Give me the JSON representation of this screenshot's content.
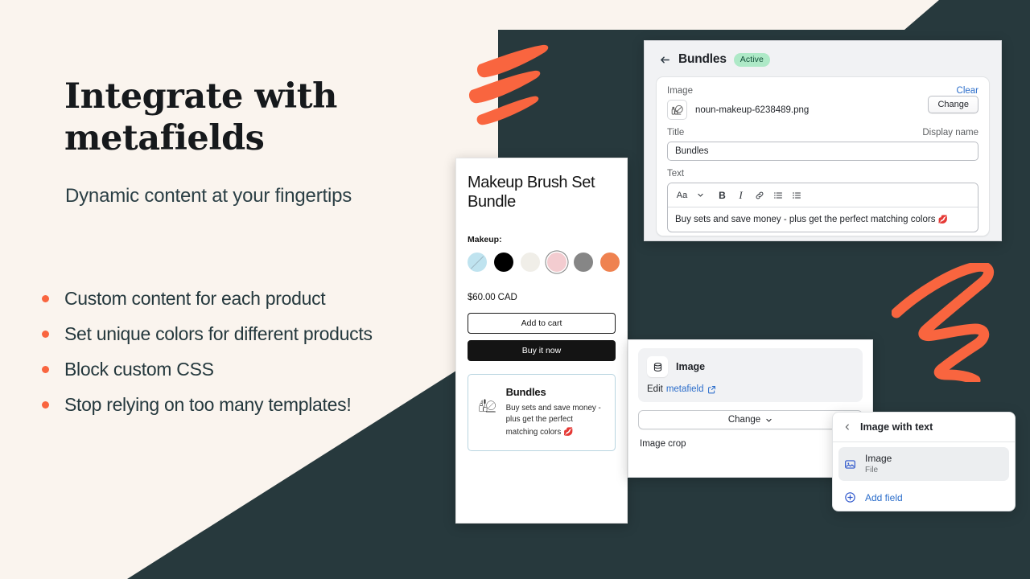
{
  "theme": {
    "cream": "#faf4ee",
    "dark": "#27393d",
    "accent": "#f9653f",
    "link_blue": "#2c6ecb",
    "badge_green": "#aee9c7"
  },
  "hero": {
    "headline_line1": "Integrate with",
    "headline_line2": "metafields",
    "subhead": "Dynamic content at your fingertips",
    "bullets": [
      "Custom content for each product",
      "Set unique colors for different products",
      "Block custom CSS",
      "Stop relying on too many templates!"
    ]
  },
  "admin_panel": {
    "back_icon": "arrow-left-icon",
    "title": "Bundles",
    "status_badge": "Active",
    "image_field": {
      "label": "Image",
      "clear_label": "Clear",
      "change_label": "Change",
      "filename": "noun-makeup-6238489.png",
      "thumb_icon": "makeup-thumbnail-icon"
    },
    "title_field": {
      "label": "Title",
      "helper": "Display name",
      "value": "Bundles"
    },
    "text_field": {
      "label": "Text",
      "toolbar": [
        {
          "name": "text-style-button",
          "glyph": "Aa"
        },
        {
          "name": "chevron-down-icon",
          "glyph": "⌄"
        },
        {
          "name": "bold-button",
          "glyph": "B"
        },
        {
          "name": "italic-button",
          "glyph": "I"
        },
        {
          "name": "link-button",
          "glyph": "link-icon"
        },
        {
          "name": "bulleted-list-button",
          "glyph": "list-icon"
        },
        {
          "name": "numbered-list-button",
          "glyph": "ordered-list-icon"
        }
      ],
      "body": "Buy sets and save money - plus get the perfect matching colors",
      "body_emoji": "💋"
    }
  },
  "storefront": {
    "product_title": "Makeup Brush Set Bundle",
    "option_label": "Makeup:",
    "swatches": [
      {
        "name": "swatch-light-blue",
        "color": "#bfe3ef",
        "unavailable": true,
        "selected": false
      },
      {
        "name": "swatch-black",
        "color": "#000000",
        "unavailable": false,
        "selected": false
      },
      {
        "name": "swatch-cream",
        "color": "#f0eee8",
        "unavailable": false,
        "selected": false
      },
      {
        "name": "swatch-pink",
        "color": "#f3ccd0",
        "unavailable": false,
        "selected": true
      },
      {
        "name": "swatch-gray",
        "color": "#868686",
        "unavailable": false,
        "selected": false
      },
      {
        "name": "swatch-orange",
        "color": "#ef8250",
        "unavailable": false,
        "selected": false
      }
    ],
    "price": "$60.00 CAD",
    "add_to_cart_label": "Add to cart",
    "buy_now_label": "Buy it now",
    "bundle_block": {
      "icon": "makeup-illustration-icon",
      "title": "Bundles",
      "description": "Buy sets and save money - plus get the perfect matching colors",
      "emoji": "💋"
    }
  },
  "image_panel": {
    "icon": "database-icon",
    "label": "Image",
    "edit_prefix": "Edit",
    "edit_link": "metafield",
    "external_icon": "external-link-icon",
    "change_label": "Change",
    "change_chevron": "chevron-down-icon",
    "crop_label": "Image crop"
  },
  "popover": {
    "back_icon": "chevron-left-icon",
    "title": "Image with text",
    "items": [
      {
        "icon": "image-file-icon",
        "title": "Image",
        "subtitle": "File",
        "active": true
      }
    ],
    "add_field_icon": "plus-circle-icon",
    "add_field_label": "Add field"
  },
  "decorations": {
    "strokes_icon": "three-diagonal-strokes",
    "zigzag_icon": "zigzag-squiggle"
  }
}
